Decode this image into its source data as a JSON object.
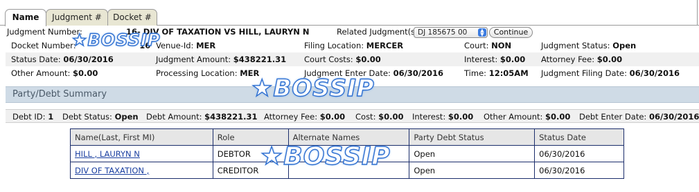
{
  "tabs": [
    {
      "label": "Name"
    },
    {
      "label": "Judgment #"
    },
    {
      "label": "Docket #"
    }
  ],
  "judgment": {
    "number_label": "Judgment Number:",
    "number_value": "16- DIV OF TAXATION VS HILL, LAURYN N",
    "related_label": "Related Judgment(s)",
    "related_value": "DJ 185675 00",
    "continue_label": "Continue",
    "rows": [
      [
        {
          "label": "Docket Number:",
          "value": "16"
        },
        {
          "label": "Venue-Id:",
          "value": "MER"
        },
        {
          "label": "Filing Location:",
          "value": "MERCER"
        },
        {
          "label": "Court:",
          "value": "NON"
        },
        {
          "label": "Judgment Status:",
          "value": "Open"
        }
      ],
      [
        {
          "label": "Status Date:",
          "value": "06/30/2016"
        },
        {
          "label": "Judgment Amount:",
          "value": "$438221.31"
        },
        {
          "label": "Court Costs:",
          "value": "$0.00"
        },
        {
          "label": "Interest:",
          "value": "$0.00"
        },
        {
          "label": "Attorney Fee:",
          "value": "$0.00"
        }
      ],
      [
        {
          "label": "Other Amount:",
          "value": "$0.00"
        },
        {
          "label": "Processing Location:",
          "value": "MER"
        },
        {
          "label": "Judgment Enter Date:",
          "value": "06/30/2016"
        },
        {
          "label": "Time:",
          "value": "12:05AM"
        },
        {
          "label": "Judgment Filing Date:",
          "value": "06/30/2016"
        }
      ]
    ]
  },
  "party_summary": {
    "title": "Party/Debt Summary",
    "debt": [
      {
        "label": "Debt ID:",
        "value": "1"
      },
      {
        "label": "Debt Status:",
        "value": "Open"
      },
      {
        "label": "Debt Amount:",
        "value": "$438221.31"
      },
      {
        "label": "Attorney Fee:",
        "value": "$0.00"
      },
      {
        "label": "Cost:",
        "value": "$0.00"
      },
      {
        "label": "Interest:",
        "value": "$0.00"
      },
      {
        "label": "Other Amount:",
        "value": "$0.00"
      },
      {
        "label": "Debt Enter Date:",
        "value": "06/30/2016"
      }
    ],
    "table": {
      "columns": [
        "Name(Last, First MI)",
        "Role",
        "Alternate Names",
        "Party Debt Status",
        "Status Date"
      ],
      "rows": [
        {
          "name": "HILL , LAURYN N",
          "role": "DEBTOR",
          "alternate": "",
          "status": "Open",
          "date": "06/30/2016"
        },
        {
          "name": "DIV OF TAXATION ,",
          "role": "CREDITOR",
          "alternate": "",
          "status": "Open",
          "date": "06/30/2016"
        }
      ]
    }
  },
  "watermark": {
    "text": "BOSSIP"
  },
  "colors": {
    "section_bg": "#cfdbe6",
    "link": "#1a3fa0",
    "table_border": "#1b2d6b",
    "watermark": "#2f6fd0"
  }
}
